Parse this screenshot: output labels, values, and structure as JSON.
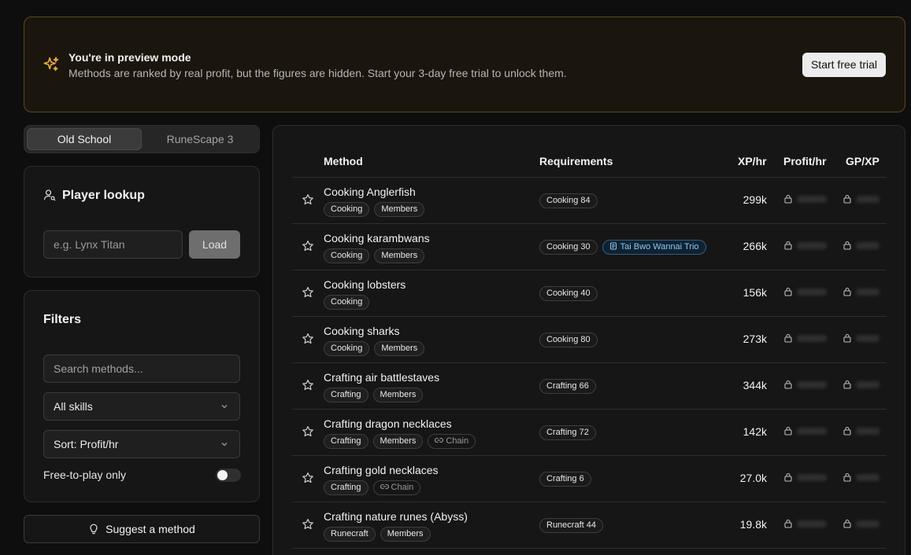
{
  "banner": {
    "title": "You're in preview mode",
    "description": "Methods are ranked by real profit, but the figures are hidden. Start your 3-day free trial to unlock them.",
    "cta": "Start free trial",
    "accent": "#e8a93a"
  },
  "game_toggle": {
    "options": [
      "Old School",
      "RuneScape 3"
    ],
    "selected": "Old School"
  },
  "player_lookup": {
    "title": "Player lookup",
    "placeholder": "e.g. Lynx Titan",
    "button": "Load"
  },
  "filters": {
    "title": "Filters",
    "search_placeholder": "Search methods...",
    "skill_select": "All skills",
    "sort_select": "Sort: Profit/hr",
    "f2p_label": "Free-to-play only",
    "f2p_enabled": false
  },
  "suggest_button": "Suggest a method",
  "table": {
    "headers": {
      "method": "Method",
      "requirements": "Requirements",
      "xp": "XP/hr",
      "profit": "Profit/hr",
      "gpxp": "GP/XP"
    },
    "rows": [
      {
        "name": "Cooking Anglerfish",
        "tags": [
          "Cooking",
          "Members"
        ],
        "chain": false,
        "reqs": [
          "Cooking 84"
        ],
        "quest": "",
        "xp": "299k"
      },
      {
        "name": "Cooking karambwans",
        "tags": [
          "Cooking",
          "Members"
        ],
        "chain": false,
        "reqs": [
          "Cooking 30"
        ],
        "quest": "Tai Bwo Wannai Trio",
        "xp": "266k"
      },
      {
        "name": "Cooking lobsters",
        "tags": [
          "Cooking"
        ],
        "chain": false,
        "reqs": [
          "Cooking 40"
        ],
        "quest": "",
        "xp": "156k"
      },
      {
        "name": "Cooking sharks",
        "tags": [
          "Cooking",
          "Members"
        ],
        "chain": false,
        "reqs": [
          "Cooking 80"
        ],
        "quest": "",
        "xp": "273k"
      },
      {
        "name": "Crafting air battlestaves",
        "tags": [
          "Crafting",
          "Members"
        ],
        "chain": false,
        "reqs": [
          "Crafting 66"
        ],
        "quest": "",
        "xp": "344k"
      },
      {
        "name": "Crafting dragon necklaces",
        "tags": [
          "Crafting",
          "Members"
        ],
        "chain": true,
        "reqs": [
          "Crafting 72"
        ],
        "quest": "",
        "xp": "142k"
      },
      {
        "name": "Crafting gold necklaces",
        "tags": [
          "Crafting"
        ],
        "chain": true,
        "reqs": [
          "Crafting 6"
        ],
        "quest": "",
        "xp": "27.0k"
      },
      {
        "name": "Crafting nature runes (Abyss)",
        "tags": [
          "Runecraft",
          "Members"
        ],
        "chain": false,
        "reqs": [
          "Runecraft 44"
        ],
        "quest": "",
        "xp": "19.8k"
      }
    ],
    "chain_label": "Chain"
  }
}
